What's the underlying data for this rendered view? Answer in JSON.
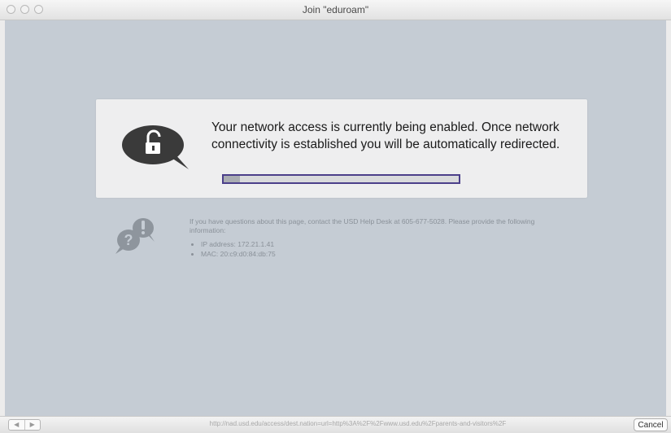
{
  "window": {
    "title": "Join \"eduroam\""
  },
  "card": {
    "message": "Your network access is currently being enabled. Once network connectivity is established you will be automatically redirected.",
    "progress_fraction": 0.07,
    "icon": "lock-speech-bubble-icon",
    "colors": {
      "progress_border": "#4b3f8a",
      "icon": "#3a3a3a"
    }
  },
  "help": {
    "icon": "question-exclamation-bubbles-icon",
    "text": "If you have questions about this page, contact the USD Help Desk at 605-677-5028. Please provide the following information:",
    "items": [
      "IP address: 172.21.1.41",
      "MAC: 20:c9:d0:84:db:75"
    ]
  },
  "statusbar": {
    "back_label": "◀",
    "forward_label": "▶",
    "url": "http://nad.usd.edu/access/dest.nation=url=http%3A%2F%2Fwww.usd.edu%2Fparents-and-visitors%2F",
    "cancel_label": "Cancel"
  },
  "colors": {
    "background": "#c5ccd4",
    "card": "#eeeeef"
  }
}
